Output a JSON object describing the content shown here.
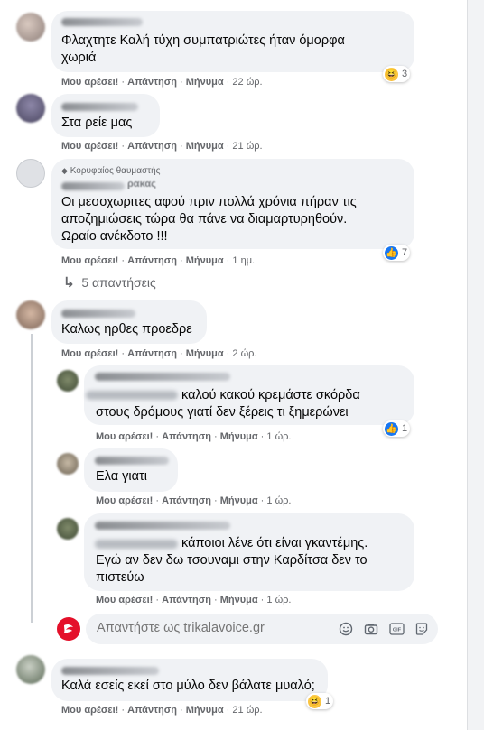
{
  "actions": {
    "like": "Μου αρέσει!",
    "reply": "Απάντηση",
    "message": "Μήνυμα"
  },
  "comments": [
    {
      "lines": [
        "Φλαχτητε Καλή τύχη συμπατριώτες ήταν όμορφα",
        "χωριά"
      ],
      "time": "22 ώρ.",
      "reaction": {
        "type": "haha",
        "count": "3"
      }
    },
    {
      "lines": [
        "Στα ρείε μας"
      ],
      "time": "21 ώρ."
    },
    {
      "badge": "Κορυφαίος θαυμαστής",
      "name_tail": "ρακας",
      "lines": [
        "Οι μεσοχωριτες αφού πριν πολλά χρόνια πήραν τις",
        "αποζημιώσεις τώρα θα πάνε να διαμαρτυρηθούν.",
        "Ωραίο ανέκδοτο !!!"
      ],
      "time": "1 ημ.",
      "reaction": {
        "type": "like",
        "count": "7"
      }
    },
    {
      "lines": [
        "Καλως ηρθες προεδρε"
      ],
      "time": "2 ώρ."
    },
    {
      "lines": [
        "καλού κακού κρεμάστε σκόρδα",
        "στους δρόμους γιατί δεν ξέρεις τι ξημερώνει"
      ],
      "time": "1 ώρ.",
      "reaction": {
        "type": "like",
        "count": "1"
      }
    },
    {
      "lines": [
        "Ελα γιατι"
      ],
      "time": "1 ώρ."
    },
    {
      "lines": [
        "κάποιοι λένε ότι είναι γκαντέμης.",
        "Εγώ αν δεν δω τσουναμι στην Καρδίτσα δεν το",
        "πιστεύω"
      ],
      "time": "1 ώρ."
    },
    {
      "lines": [
        "Καλά εσείς εκεί στο μύλο δεν βάλατε μυαλό;"
      ],
      "time": "21 ώρ.",
      "reaction": {
        "type": "haha",
        "count": "1"
      }
    }
  ],
  "replies_link": "5 απαντήσεις",
  "reply_box": {
    "placeholder": "Απαντήστε ως trikalavoice.gr"
  },
  "icons": [
    "smile-icon",
    "camera-icon",
    "gif-icon",
    "sticker-icon",
    "like-reaction-icon",
    "haha-reaction-icon",
    "diamond-icon"
  ],
  "colors": {
    "bubble": "#f0f2f5",
    "meta": "#65676b",
    "like": "#1877f2",
    "page_avatar": "#e4102a"
  }
}
